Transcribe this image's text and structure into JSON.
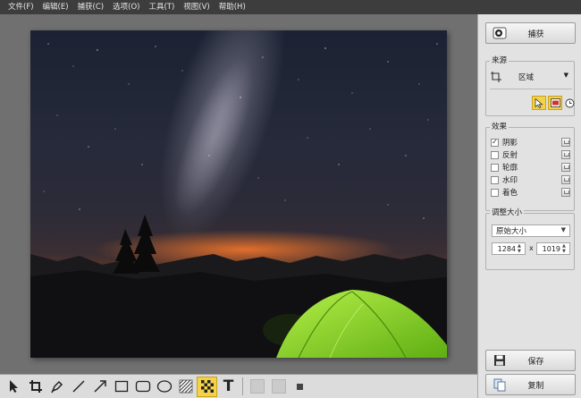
{
  "menu": [
    {
      "id": "file",
      "label": "文件(F)"
    },
    {
      "id": "edit",
      "label": "编辑(E)"
    },
    {
      "id": "capture",
      "label": "捕获(C)"
    },
    {
      "id": "options",
      "label": "选项(O)"
    },
    {
      "id": "tools",
      "label": "工具(T)"
    },
    {
      "id": "view",
      "label": "视图(V)"
    },
    {
      "id": "help",
      "label": "帮助(H)"
    }
  ],
  "sidebar": {
    "capture_button": "捕获",
    "source": {
      "title": "来源",
      "mode": "区域"
    },
    "effects": {
      "title": "效果",
      "items": [
        {
          "label": "阴影",
          "checked": true
        },
        {
          "label": "反射",
          "checked": false
        },
        {
          "label": "轮廓",
          "checked": false
        },
        {
          "label": "水印",
          "checked": false
        },
        {
          "label": "着色",
          "checked": false
        }
      ]
    },
    "resize": {
      "title": "调整大小",
      "mode": "原始大小",
      "width": "1284",
      "separator": "x",
      "height": "1019"
    },
    "save_button": "保存",
    "copy_button": "复制"
  },
  "toolbar": {
    "tools": [
      {
        "id": "select",
        "icon": "arrow-pointer-icon"
      },
      {
        "id": "crop",
        "icon": "crop-icon"
      },
      {
        "id": "pen",
        "icon": "pen-icon"
      },
      {
        "id": "line",
        "icon": "line-icon"
      },
      {
        "id": "arrow",
        "icon": "arrow-line-icon"
      },
      {
        "id": "rectangle",
        "icon": "rectangle-icon"
      },
      {
        "id": "rounded-rectangle",
        "icon": "rounded-rectangle-icon"
      },
      {
        "id": "ellipse",
        "icon": "ellipse-icon"
      },
      {
        "id": "hatch",
        "icon": "hatch-icon"
      },
      {
        "id": "pixelate",
        "icon": "checker-icon",
        "active": true
      },
      {
        "id": "text",
        "icon": "text-icon",
        "label": "T"
      }
    ]
  },
  "colors": {
    "active_tool": "#f3d24a",
    "menubar": "#3d3d3d",
    "sidebar": "#e2e2e2",
    "tent": "#7ed321"
  }
}
